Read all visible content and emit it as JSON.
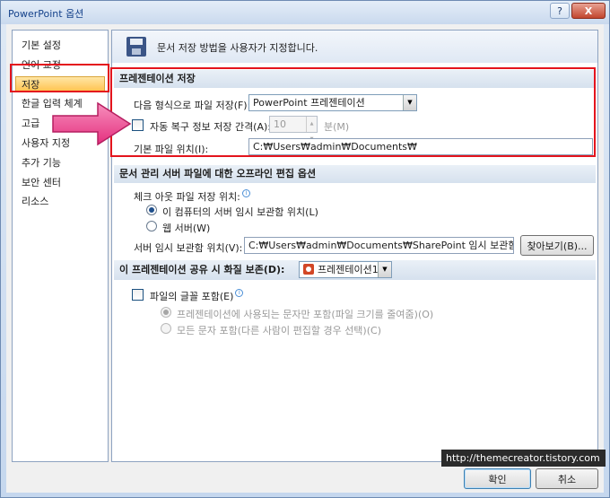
{
  "window": {
    "title": "PowerPoint 옵션",
    "help_label": "?",
    "close_label": "X"
  },
  "sidebar": {
    "items": [
      {
        "label": "기본 설정"
      },
      {
        "label": "언어 교정"
      },
      {
        "label": "저장"
      },
      {
        "label": "한글 입력 체계"
      },
      {
        "label": "고급"
      },
      {
        "label": "사용자 지정"
      },
      {
        "label": "추가 기능"
      },
      {
        "label": "보안 센터"
      },
      {
        "label": "리소스"
      }
    ],
    "selected_index": 2
  },
  "header": {
    "text": "문서 저장 방법을 사용자가 지정합니다."
  },
  "save_presentations": {
    "title": "프레젠테이션 저장",
    "format_label": "다음 형식으로 파일 저장(F):",
    "format_value": "PowerPoint 프레젠테이션",
    "autorecover_label": "자동 복구 정보 저장 간격(A):",
    "autorecover_value": "10",
    "autorecover_unit": "분(M)",
    "default_location_label": "기본 파일 위치(I):",
    "default_location_value": "C:₩Users₩admin₩Documents₩"
  },
  "offline_editing": {
    "title": "문서 관리 서버 파일에 대한 오프라인 편집 옵션",
    "checkout_label": "체크 아웃 파일 저장 위치:",
    "option_local": "이 컴퓨터의 서버 임시 보관함 위치(L)",
    "option_web": "웹 서버(W)",
    "drafts_label": "서버 임시 보관함 위치(V):",
    "drafts_value": "C:₩Users₩admin₩Documents₩SharePoint 임시 보관함₩",
    "browse_label": "찾아보기(B)..."
  },
  "fidelity": {
    "title": "이 프레젠테이션 공유 시 화질 보존(D):",
    "presentation_value": "프레젠테이션1",
    "embed_fonts_label": "파일의 글꼴 포함(E)",
    "embed_used_label": "프레젠테이션에 사용되는 문자만 포함(파일 크기를 줄여줌)(O)",
    "embed_all_label": "모든 문자 포함(다른 사람이 편집할 경우 선택)(C)"
  },
  "footer": {
    "ok_label": "확인",
    "cancel_label": "취소"
  },
  "watermark": {
    "text": "http://themecreator.tistory.com"
  },
  "colors": {
    "highlight": "#e4141d",
    "arrow": "#ee3f8b",
    "selected": "#ffc24d",
    "accent": "#15428b"
  }
}
